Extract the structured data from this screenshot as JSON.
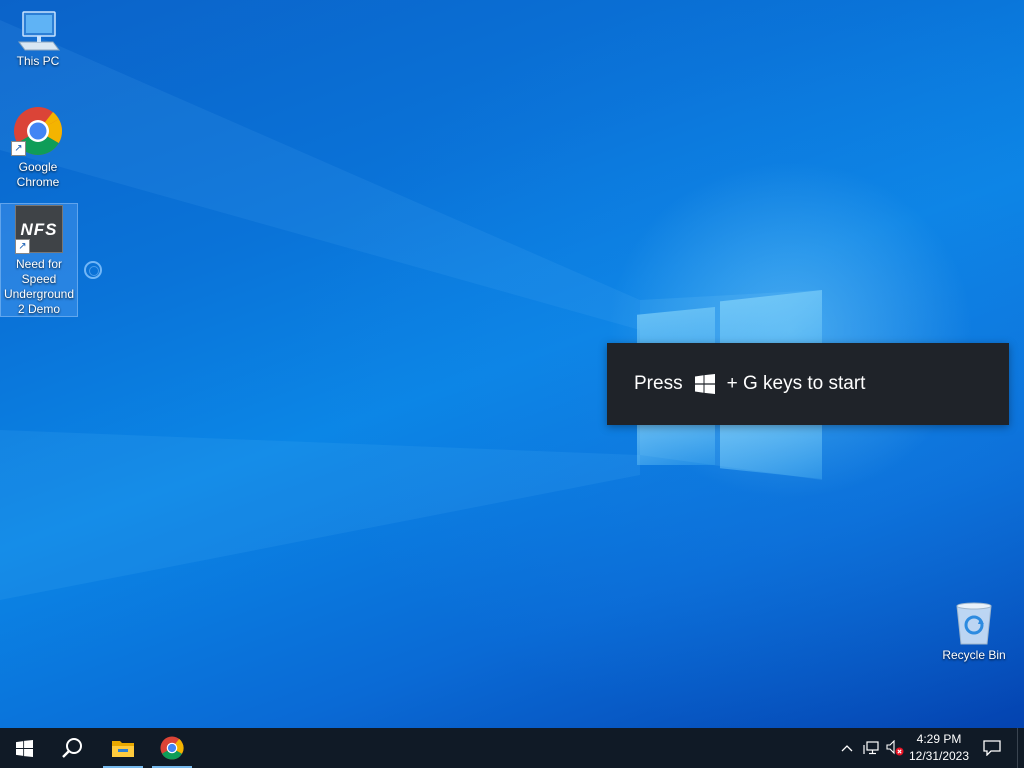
{
  "desktop_icons": {
    "this_pc": "This PC",
    "chrome": "Google Chrome",
    "nfs": "Need for Speed Underground 2 Demo",
    "nfs_logo_text": "NFS",
    "recycle_bin": "Recycle Bin"
  },
  "toast": {
    "prefix": "Press",
    "suffix": "+ G keys to start"
  },
  "taskbar": {
    "pinned": [
      {
        "name": "start",
        "icon": "windows-logo-icon"
      },
      {
        "name": "search",
        "icon": "search-icon"
      },
      {
        "name": "file-explorer",
        "icon": "folder-icon",
        "active": true
      },
      {
        "name": "chrome",
        "icon": "chrome-icon",
        "active": true
      }
    ],
    "tray_icons": [
      "chevron-up-icon",
      "network-icon",
      "volume-muted-icon"
    ],
    "time": "4:29 PM",
    "date": "12/31/2023",
    "notification_icon": "action-center-icon"
  },
  "colors": {
    "taskbar": "#101a26",
    "toast_bg": "#1f2329",
    "accent": "#76b9ed"
  }
}
